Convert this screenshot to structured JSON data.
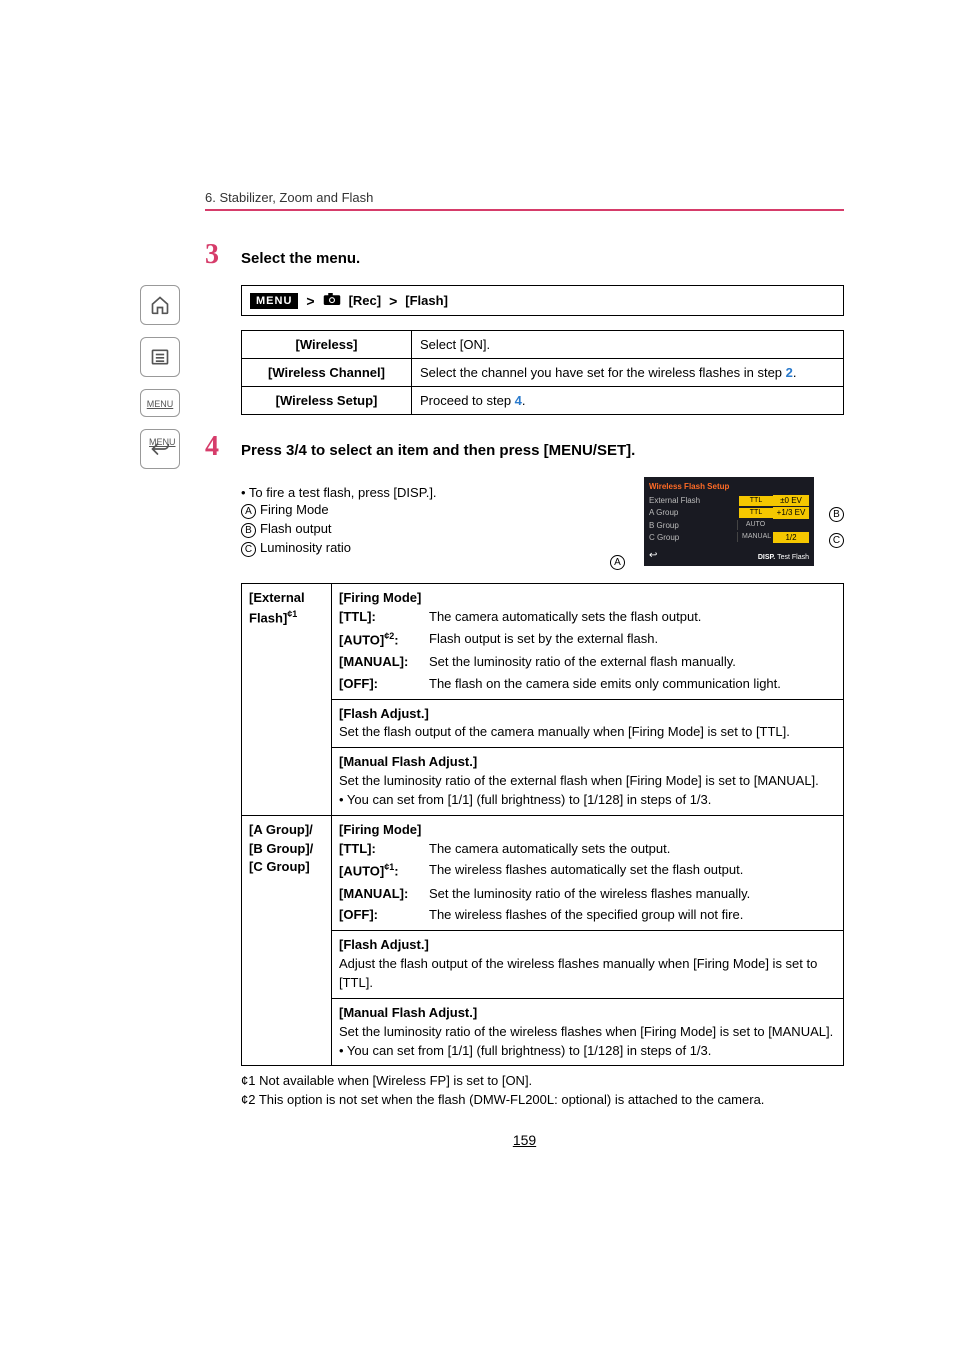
{
  "chapter": "6. Stabilizer, Zoom and Flash",
  "sidebar": {
    "menu_label": "MENU"
  },
  "steps": {
    "s3": {
      "num": "3",
      "text": "Select the menu."
    },
    "s4": {
      "num": "4",
      "text": "Press 3/4 to select an item and then press [MENU/SET]."
    }
  },
  "menu_path": {
    "menu": "MENU",
    "rec": "[Rec]",
    "flash": "[Flash]"
  },
  "settings_table": [
    {
      "name": "[Wireless]",
      "desc": "Select [ON]."
    },
    {
      "name": "[Wireless Channel]",
      "desc_prefix": "Select the channel you have set for the wireless flashes in step ",
      "blue": "2",
      "desc_suffix": "."
    },
    {
      "name": "[Wireless Setup]",
      "desc_prefix": "Proceed to step ",
      "blue": "4",
      "desc_suffix": "."
    }
  ],
  "notes": {
    "test_flash": "• To fire a test flash, press [DISP.].",
    "a_label": "Firing Mode",
    "b_label": "Flash output",
    "c_label": "Luminosity ratio"
  },
  "screenshot": {
    "title": "Wireless Flash Setup",
    "rows": [
      {
        "name": "External Flash",
        "mid": "TTL",
        "end": "±0 EV"
      },
      {
        "name": "A Group",
        "mid": "TTL",
        "end": "+1/3 EV"
      },
      {
        "name": "B Group",
        "mid": "AUTO",
        "end": ""
      },
      {
        "name": "C Group",
        "mid": "MANUAL",
        "end": "1/2"
      }
    ],
    "footer_disp": "DISP.",
    "footer_test": "Test Flash"
  },
  "modes_table": {
    "external": {
      "rowhead": "[External Flash]",
      "rowhead_sup": "¢1",
      "firing_head": "[Firing Mode]",
      "modes": [
        {
          "k": "[TTL]:",
          "v": "The camera automatically sets the flash output."
        },
        {
          "k": "[AUTO]",
          "ksup": "¢2",
          "ksuf": ":",
          "v": "Flash output is set by the external flash."
        },
        {
          "k": "[MANUAL]:",
          "v": "Set the luminosity ratio of the external flash manually."
        },
        {
          "k": "[OFF]:",
          "v": "The flash on the camera side emits only communication light."
        }
      ],
      "flash_adj_head": "[Flash Adjust.]",
      "flash_adj_body": "Set the flash output of the camera manually when [Firing Mode] is set to [TTL].",
      "manual_adj_head": "[Manual Flash Adjust.]",
      "manual_adj_body1": "Set the luminosity ratio of the external flash when [Firing Mode] is set to [MANUAL].",
      "manual_adj_body2": "• You can set from [1/1] (full brightness) to [1/128] in steps of 1/3."
    },
    "groups": {
      "rowhead": "[A Group]/\n[B Group]/\n[C Group]",
      "firing_head": "[Firing Mode]",
      "modes": [
        {
          "k": "[TTL]:",
          "v": "The camera automatically sets the output."
        },
        {
          "k": "[AUTO]",
          "ksup": "¢1",
          "ksuf": ":",
          "v": "The wireless flashes automatically set the flash output."
        },
        {
          "k": "[MANUAL]:",
          "v": "Set the luminosity ratio of the wireless flashes manually."
        },
        {
          "k": "[OFF]:",
          "v": "The wireless flashes of the specified group will not fire."
        }
      ],
      "flash_adj_head": "[Flash Adjust.]",
      "flash_adj_body": "Adjust the flash output of the wireless flashes manually when [Firing Mode] is set to [TTL].",
      "manual_adj_head": "[Manual Flash Adjust.]",
      "manual_adj_body1": "Set the luminosity ratio of the wireless flashes when [Firing Mode] is set to [MANUAL].",
      "manual_adj_body2": "• You can set from [1/1] (full brightness) to [1/128] in steps of 1/3."
    }
  },
  "footnotes": {
    "f1": "¢1 Not available when [Wireless FP] is set to [ON].",
    "f2": "¢2 This option is not set when the flash (DMW-FL200L: optional) is attached to the camera."
  },
  "page_number": "159"
}
